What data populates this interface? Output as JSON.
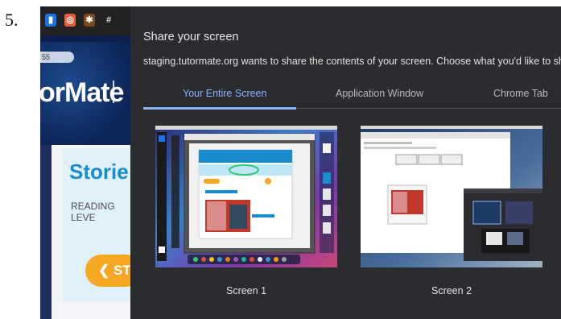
{
  "step": {
    "number": "5."
  },
  "background_app": {
    "pill_text": "55",
    "brand": "orMate",
    "stories": "Storie",
    "reading_level": "READING LEVE",
    "start_button": "ST"
  },
  "dialog": {
    "title": "Share your screen",
    "description": "staging.tutormate.org wants to share the contents of your screen. Choose what you'd like to share.",
    "tabs": [
      {
        "label": "Your Entire Screen",
        "active": true
      },
      {
        "label": "Application Window",
        "active": false
      },
      {
        "label": "Chrome Tab",
        "active": false
      }
    ],
    "screens": [
      {
        "label": "Screen 1",
        "selected": true
      },
      {
        "label": "Screen 2",
        "selected": false
      }
    ]
  },
  "colors": {
    "dialog_bg": "#2b2c30",
    "accent": "#8ab4f8",
    "selected_tile": "#1e3b66"
  }
}
